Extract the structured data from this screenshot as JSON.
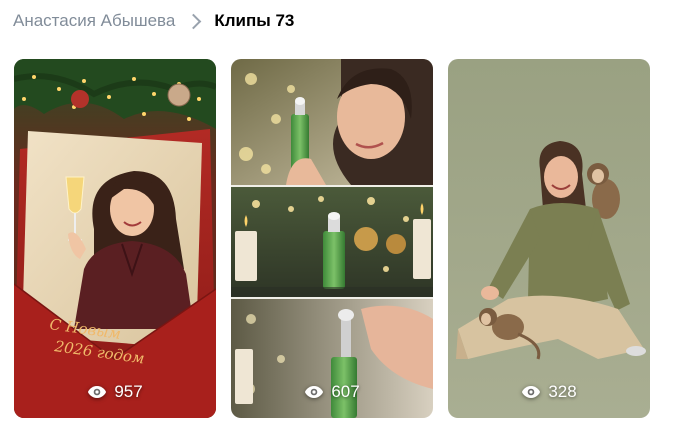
{
  "breadcrumb": {
    "author": "Анастасия Абышева",
    "section": "Клипы 73",
    "separator_icon": "chevron-right-icon"
  },
  "clips": [
    {
      "views": "957",
      "views_icon": "eye-icon",
      "greeting": "С Новым 2026 годом"
    },
    {
      "views": "607",
      "views_icon": "eye-icon"
    },
    {
      "views": "328",
      "views_icon": "eye-icon"
    }
  ],
  "colors": {
    "breadcrumb_link": "#818c99",
    "breadcrumb_current": "#000000",
    "view_text": "#ffffff"
  }
}
